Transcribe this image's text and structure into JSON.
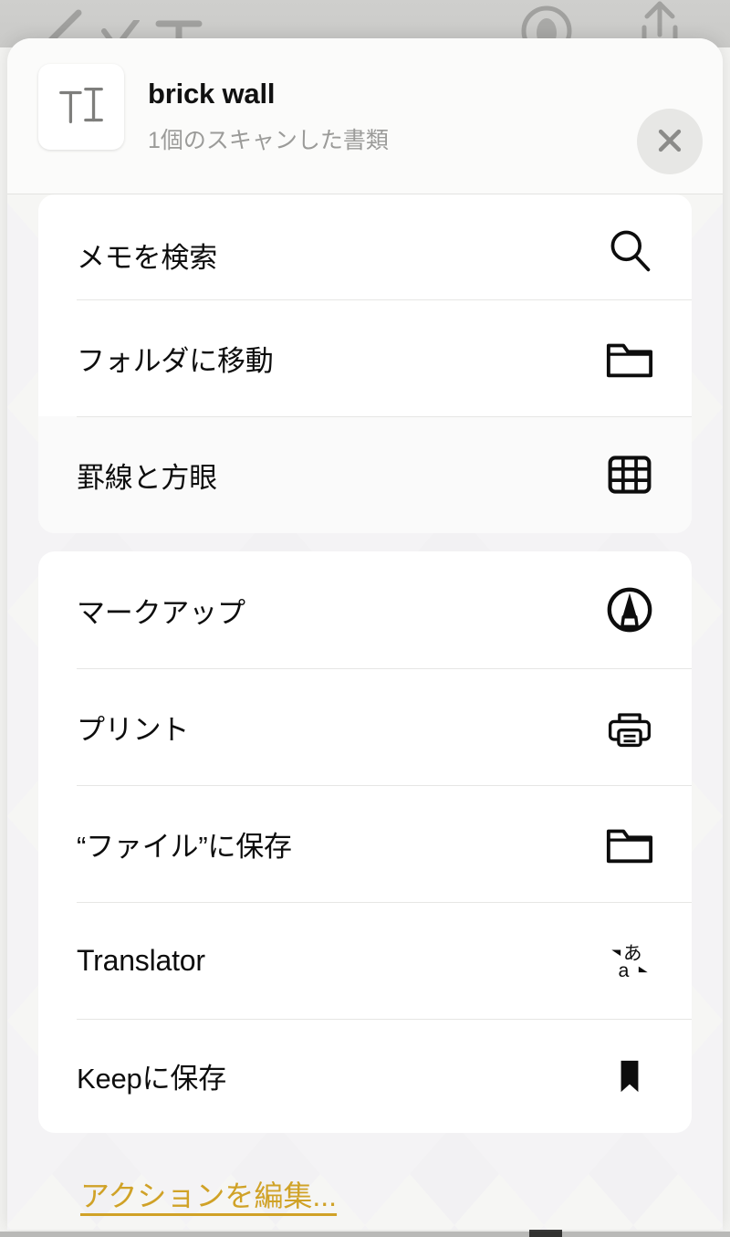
{
  "backdrop": {
    "icons": [
      {
        "name": "pen-icon"
      },
      {
        "name": "checkmark-icon"
      },
      {
        "name": "text-format-icon"
      },
      {
        "name": "scan-document-icon"
      },
      {
        "name": "share-icon"
      }
    ]
  },
  "header": {
    "title": "brick wall",
    "subtitle": "1個のスキャンした書類",
    "thumbnail_icon": "scanned-document-thumbnail",
    "close_label": "×",
    "close_icon": "close-icon"
  },
  "action_groups": [
    {
      "id": "group-primary",
      "rows": [
        {
          "label": "メモを検索",
          "icon": "search-icon",
          "clipped": true,
          "tinted": false,
          "height": 115
        },
        {
          "label": "フォルダに移動",
          "icon": "folder-icon",
          "clipped": false,
          "tinted": false,
          "height": 128
        },
        {
          "label": "罫線と方眼",
          "icon": "grid-icon",
          "clipped": false,
          "tinted": true,
          "height": 128
        }
      ]
    },
    {
      "id": "group-secondary",
      "rows": [
        {
          "label": "マークアップ",
          "icon": "markup-pen-icon",
          "clipped": false,
          "tinted": false,
          "height": 128
        },
        {
          "label": "プリント",
          "icon": "printer-icon",
          "clipped": false,
          "tinted": false,
          "height": 128
        },
        {
          "label": "“ファイル”に保存",
          "icon": "folder-icon",
          "clipped": false,
          "tinted": false,
          "height": 128
        },
        {
          "label": "Translator",
          "icon": "translate-icon",
          "clipped": false,
          "tinted": false,
          "height": 128,
          "latin": true
        },
        {
          "label": "Keepに保存",
          "icon": "bookmark-icon",
          "clipped": false,
          "tinted": false,
          "height": 125
        }
      ]
    }
  ],
  "footer": {
    "edit_actions_label": "アクションを編集..."
  },
  "colors": {
    "accent_gold": "#d0a227",
    "sheet_background": "#f6f6f4",
    "card_background": "#ffffff",
    "label_text": "#0d0d0d",
    "subtitle_text": "#9b9b99",
    "separator": "#e6e6e4",
    "close_button_background": "#e7e7e5",
    "close_button_glyph": "#8b8b89"
  }
}
